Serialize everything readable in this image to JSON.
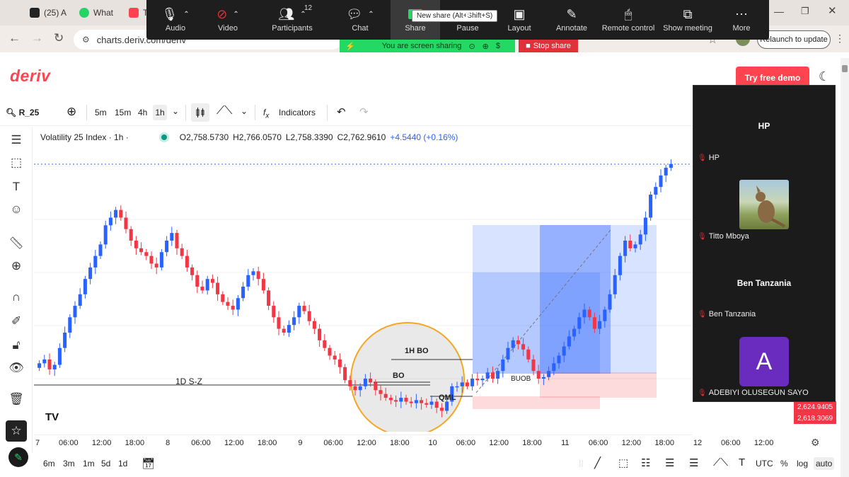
{
  "browser": {
    "tabs": [
      "(25) A",
      "What",
      "T"
    ],
    "url": "charts.deriv.com/deriv",
    "relaunch": "Relaunch to update"
  },
  "zoom": {
    "toolbar": [
      "Audio",
      "Video",
      "Participants",
      "Chat",
      "Share",
      "Pause",
      "Layout",
      "Annotate",
      "Remote control",
      "Show meeting",
      "More"
    ],
    "participants_count": "12",
    "tooltip": "New share (Alt+Shift+S)",
    "sharing_text": "You are screen sharing",
    "stop_share": "Stop share",
    "panel": {
      "p1_title": "HP",
      "p1_label": "HP",
      "p2_label": "Titto Mboya",
      "p3_title": "Ben Tanzania",
      "p3_label": "Ben Tanzania",
      "p4_avatar": "A",
      "p4_label": "ADEBIYI OLUSEGUN SAYO"
    }
  },
  "deriv": {
    "logo": "deriv",
    "try_demo": "Try free demo"
  },
  "toolbar": {
    "symbol": "R_25",
    "intervals": [
      "5m",
      "15m",
      "4h",
      "1h"
    ],
    "indicators": "Indicators"
  },
  "legend": {
    "title": "Volatility 25 Index · 1h ·",
    "o": "O2,758.5730",
    "h": "H2,766.0570",
    "l": "L2,758.3390",
    "c": "C2,762.9610",
    "chg": "+4.5440 (+0.16%)"
  },
  "chart_data": {
    "type": "candlestick",
    "annotations": [
      "1D S-Z",
      "1H BO",
      "BO",
      "QML",
      "BUOB"
    ],
    "x_labels": [
      "7",
      "06:00",
      "12:00",
      "18:00",
      "8",
      "06:00",
      "12:00",
      "18:00",
      "9",
      "06:00",
      "12:00",
      "18:00",
      "10",
      "06:00",
      "12:00",
      "18:00",
      "11",
      "06:00",
      "12:00",
      "18:00",
      "12",
      "06:00",
      "12:00"
    ],
    "price_tags": [
      "2,624.9405",
      "2,618.3069"
    ],
    "up_color": "#2962ff",
    "down_color": "#f23645",
    "closes": [
      500,
      505,
      492,
      498,
      520,
      540,
      560,
      575,
      590,
      610,
      625,
      640,
      655,
      680,
      690,
      700,
      690,
      675,
      660,
      650,
      645,
      640,
      630,
      625,
      645,
      660,
      670,
      650,
      640,
      625,
      615,
      600,
      595,
      610,
      605,
      590,
      580,
      575,
      570,
      585,
      600,
      615,
      620,
      610,
      595,
      575,
      560,
      545,
      540,
      550,
      560,
      575,
      568,
      555,
      545,
      530,
      520,
      510,
      505,
      495,
      478,
      470,
      465,
      470,
      480,
      475,
      465,
      460,
      455,
      452,
      450,
      455,
      450,
      448,
      452,
      448,
      446,
      450,
      442,
      438,
      450,
      470,
      470,
      475,
      470,
      480,
      478,
      480,
      488,
      480,
      490,
      505,
      520,
      530,
      525,
      518,
      505,
      490,
      480,
      482,
      490,
      500,
      510,
      522,
      535,
      545,
      560,
      570,
      560,
      545,
      555,
      570,
      590,
      615,
      640,
      660,
      650,
      655,
      668,
      690,
      720,
      730,
      745,
      755,
      760
    ]
  },
  "bottom": {
    "intervals": [
      "6m",
      "3m",
      "1m",
      "5d",
      "1d"
    ],
    "right": [
      "UTC",
      "%",
      "log",
      "auto"
    ]
  }
}
